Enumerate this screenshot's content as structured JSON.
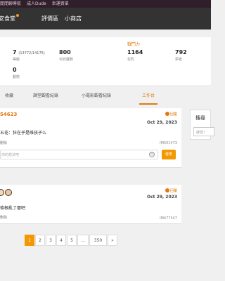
{
  "topbar": {
    "items": [
      "閒閒聊導航",
      "成人Dude",
      "幸運資單"
    ]
  },
  "nav": {
    "items": [
      "安食堂",
      "評價區",
      "小商店"
    ]
  },
  "stats": {
    "level": {
      "value": "7",
      "detail": "(13772/14175)",
      "label": "等級"
    },
    "coins": {
      "value": "800",
      "label": "可收藏數"
    },
    "posts": {
      "value": "0",
      "label": "動態"
    },
    "battle_title": "戰鬥力",
    "bp1": {
      "value": "1164",
      "label": "巨乳"
    },
    "bp2": {
      "value": "792",
      "label": "夢者"
    }
  },
  "tabs": [
    "收藏",
    "課堂觀看紀錄",
    "小電影觀看紀錄",
    "工作台"
  ],
  "card1": {
    "username": "54623",
    "badge": "回覆",
    "date": "Oct 29, 2023",
    "text": "五花：狂在乎是唯孩子么",
    "delete": "刪除",
    "id": "IM501473",
    "reply_placeholder": "你的想法吧",
    "emoji": "☺",
    "send": "發表"
  },
  "card2": {
    "badge": "回覆",
    "date": "Oct 29, 2023",
    "text": "條根亂了層吧",
    "delete": "刪除",
    "id": "IM477547"
  },
  "sidebar": {
    "title": "搜尋",
    "input_placeholder": "搜尋！"
  },
  "pagination": [
    "1",
    "2",
    "3",
    "4",
    "5",
    "...",
    "350",
    "»"
  ]
}
